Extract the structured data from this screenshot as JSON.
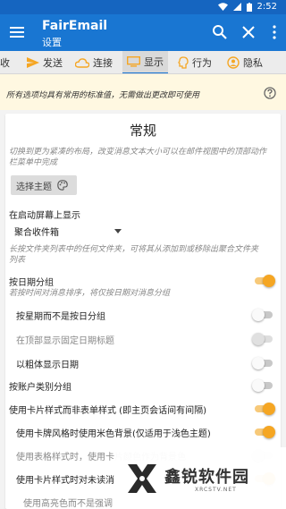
{
  "status": {
    "time": "2:52"
  },
  "appbar": {
    "title": "FairEmail",
    "subtitle": "设置"
  },
  "tabs": [
    {
      "label": "收",
      "icon": "inbox-icon"
    },
    {
      "label": "发送",
      "icon": "send-icon"
    },
    {
      "label": "连接",
      "icon": "cloud-icon"
    },
    {
      "label": "显示",
      "icon": "monitor-icon"
    },
    {
      "label": "行为",
      "icon": "behavior-icon"
    },
    {
      "label": "隐私",
      "icon": "privacy-icon"
    }
  ],
  "active_tab": "显示",
  "info": {
    "text": "所有选项均具有常用的标准值，无需做出更改即可使用"
  },
  "section": {
    "title": "常规",
    "hint1": "切换到更为紧凑的布局，改变消息文本大小可以在邮件视图中的顶部动作栏菜单中完成",
    "theme_button": "选择主题",
    "startup_label": "在启动屏幕上显示",
    "startup_value": "聚合收件箱",
    "hint2": "长按文件夹列表中的任何文件夹，可将其从添加到或移除出聚合文件夹列表",
    "group_by_date": "按日期分组",
    "group_by_date_hint": "若按时间对消息排序，将仅按日期对消息分组",
    "group_by_week": "按星期而不是按日分组",
    "fixed_date_header": "在顶部显示固定日期标题",
    "bold_date": "以粗体显示日期",
    "group_by_account": "按账户类别分组",
    "card_style": "使用卡片样式而非表单样式 (即主页会话间有间隔)",
    "beige_bg": "使用卡牌风格时使用米色背景(仅适用于浅色主题)",
    "card_color_bg": "使用表格样式时，使用卡片颜色作为背景色",
    "card_style_align": "使用卡片样式时对未读消",
    "highlight_color": "使用高亮色而不是强调"
  },
  "switch_states": {
    "group_by_date": true,
    "group_by_week": false,
    "fixed_date_header": false,
    "bold_date": false,
    "group_by_account": false,
    "card_style": true,
    "beige_bg": true,
    "card_color_bg": false,
    "card_style_align": true
  },
  "watermark": {
    "name": "鑫锐软件园",
    "url": "XRCSTV.NET"
  },
  "colors": {
    "primary": "#1976d2",
    "statusbar": "#1565c0",
    "accent": "#f5a623",
    "info_bg": "#fff8e1"
  }
}
